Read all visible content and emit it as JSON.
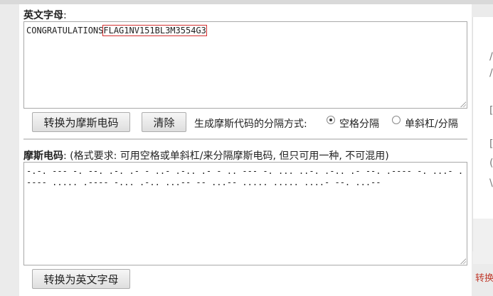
{
  "english_section": {
    "label": "英文字母",
    "colon": ":",
    "text_prefix": "CONGRATULATIONS",
    "text_flag": "FLAG1NV151BL3M3554G3"
  },
  "buttons": {
    "to_morse": "转换为摩斯电码",
    "clear": "清除",
    "to_english": "转换为英文字母"
  },
  "separator": {
    "label": "生成摩斯代码的分隔方式:",
    "options": [
      "空格分隔",
      "单斜杠/分隔"
    ],
    "selected": 0
  },
  "morse_section": {
    "label": "摩斯电码",
    "hint": ":  (格式要求: 可用空格或单斜杠/来分隔摩斯电码, 但只可用一种, 不可混用)",
    "text": "-.-. --- -. --. .-. .- - ..- .-.. .- - .. --- -. ... ..-. .-.. .- --. .---- -. ...- .---- ..... .---- -... .-.. ...-- -- ...-- ..... ..... ....- --. ...--"
  },
  "right_panel": {
    "glyphs": [
      "/",
      "/",
      "[",
      "[",
      "(",
      "\\"
    ],
    "red_text": "转换"
  }
}
